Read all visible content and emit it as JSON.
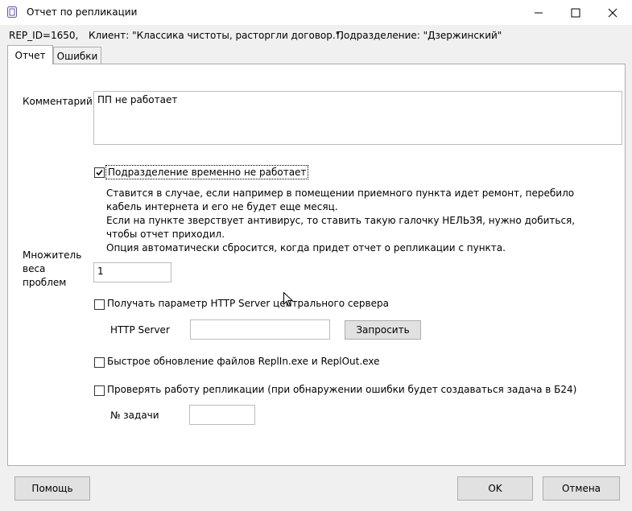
{
  "window": {
    "title": "Отчет по репликации",
    "controls": [
      "minimize-icon",
      "maximize-icon",
      "close-icon"
    ]
  },
  "info": {
    "rep_id": "REP_ID=1650,",
    "client": "Клиент: \"Классика чистоты, расторгли договор.\",",
    "department": "Подразделение: \"Дзержинский\""
  },
  "tabs": [
    {
      "label": "Отчет",
      "active": true
    },
    {
      "label": "Ошибки",
      "active": false
    }
  ],
  "form": {
    "comment_label": "Комментарий",
    "comment_value": "ПП не работает",
    "dept_disabled": {
      "label": "Подразделение временно не работает",
      "checked": true
    },
    "description": [
      "Ставится в случае, если например в помещении приемного пункта идет ремонт, перебило",
      "кабель интернета и его не будет еще месяц.",
      "Если на пункте зверствует антивирус, то ставить такую галочку НЕЛЬЗЯ, нужно добиться,",
      "чтобы отчет приходил.",
      "Опция автоматически сбросится, когда придет отчет о репликации с пункта."
    ],
    "weight_label_lines": [
      "Множитель",
      "веса",
      "проблем"
    ],
    "weight_value": "1",
    "http_param": {
      "label": "Получать параметр HTTP Server центрального  сервера",
      "checked": false
    },
    "http_server_label": "HTTP Server",
    "http_server_value": "",
    "request_button": "Запросить",
    "fast_update": {
      "label": "Быстрое обновление файлов ReplIn.exe и ReplOut.exe",
      "checked": false
    },
    "check_replication": {
      "label": "Проверять работу репликации (при обнаружении ошибки будет создаваться задача в Б24)",
      "checked": false
    },
    "task_label": "№ задачи",
    "task_value": ""
  },
  "footer": {
    "help": "Помощь",
    "ok": "OK",
    "cancel": "Отмена"
  }
}
